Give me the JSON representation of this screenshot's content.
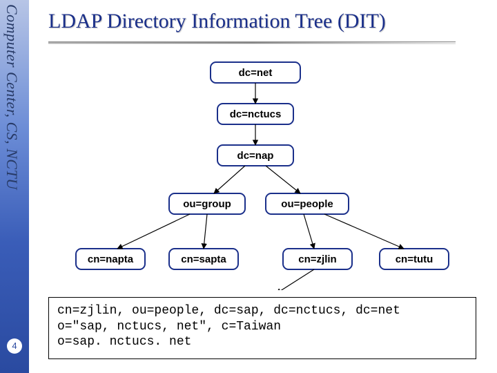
{
  "sidebar": {
    "label": "Computer Center, CS, NCTU"
  },
  "page_number": "4",
  "title": "LDAP Directory Information Tree (DIT)",
  "nodes": {
    "root": {
      "label": "dc=net"
    },
    "n1": {
      "label": "dc=nctucs"
    },
    "n2": {
      "label": "dc=nap"
    },
    "ou1": {
      "label": "ou=group"
    },
    "ou2": {
      "label": "ou=people"
    },
    "cn1": {
      "label": "cn=napta"
    },
    "cn2": {
      "label": "cn=sapta"
    },
    "cn3": {
      "label": "cn=zjlin"
    },
    "cn4": {
      "label": "cn=tutu"
    }
  },
  "dn_lines": {
    "l1": "cn=zjlin, ou=people, dc=sap, dc=nctucs, dc=net",
    "l2": "o=\"sap, nctucs, net\", c=Taiwan",
    "l3": "o=sap. nctucs. net"
  },
  "tree_edges": [
    [
      "root",
      "n1"
    ],
    [
      "n1",
      "n2"
    ],
    [
      "n2",
      "ou1"
    ],
    [
      "n2",
      "ou2"
    ],
    [
      "ou1",
      "cn1"
    ],
    [
      "ou1",
      "cn2"
    ],
    [
      "ou2",
      "cn3"
    ],
    [
      "ou2",
      "cn4"
    ]
  ],
  "chart_data": {
    "type": "table",
    "title": "LDAP Directory Information Tree (DIT)",
    "tree": {
      "dc=net": {
        "dc=nctucs": {
          "dc=nap": {
            "ou=group": [
              "cn=napta",
              "cn=sapta"
            ],
            "ou=people": [
              "cn=zjlin",
              "cn=tutu"
            ]
          }
        }
      }
    },
    "dn_example": [
      "cn=zjlin, ou=people, dc=sap, dc=nctucs, dc=net",
      "o=\"sap, nctucs, net\", c=Taiwan",
      "o=sap. nctucs. net"
    ]
  }
}
